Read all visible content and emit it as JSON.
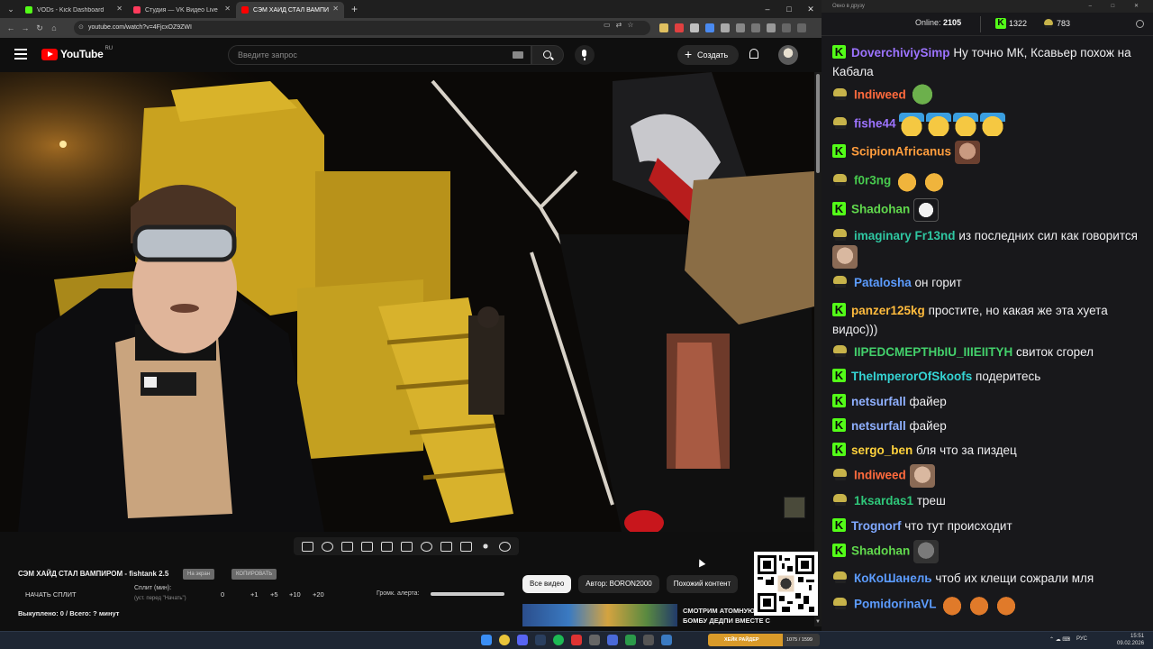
{
  "browser": {
    "tabs": [
      {
        "title": "VODs - Kick Dashboard",
        "favicon_color": "#53fc18"
      },
      {
        "title": "Студия — VK Видео Live",
        "favicon_color": "#ff3b5c"
      },
      {
        "title": "СЭМ ХАЙД СТАЛ ВАМПИР",
        "favicon_color": "#ff0000",
        "active": true
      }
    ],
    "url": "youtube.com/watch?v=4FjcxOZ9ZWI"
  },
  "youtube": {
    "logo_text": "YouTube",
    "region": "RU",
    "search_placeholder": "Введите запрос",
    "create_label": "Создать"
  },
  "stream_panel": {
    "title": "СЭМ ХАЙД СТАЛ ВАМПИРОМ - fishtank 2.5",
    "pill_hide": "На экран",
    "pill_copy": "КОПИРОВАТЬ",
    "start_split": "НАЧАТЬ СПЛИТ",
    "split_min_label": "Сплит (мин):",
    "split_hint": "(уст. перед \"Начать\")",
    "split_value": "0",
    "increments": [
      "+1",
      "+5",
      "+10",
      "+20"
    ],
    "alert_volume_label": "Громк. алерта:",
    "alert_volume": 1.0,
    "payout": "Выкуплено: 0 / Всего: ? минут"
  },
  "filter_chips": [
    "Все видео",
    "Автор: BORON2000",
    "Похожий контент"
  ],
  "recommendation": {
    "title": "СМОТРИМ АТОМНУЮ БОМБУ ДЕДПИ ВМЕСТЕ С ..."
  },
  "chat": {
    "window_title": "Окно в друзу",
    "online_label": "Online:",
    "online_count": "2105",
    "kick_count": "1322",
    "vk_count": "783",
    "messages": [
      {
        "platform": "kick",
        "user": "DoverchiviySimp",
        "color": "#9c73ff",
        "text": "Ну точно МК, Ксавьер похож на Кабала",
        "emotes": []
      },
      {
        "platform": "vk",
        "user": "Indiweed",
        "color": "#ff6a3d",
        "text": "",
        "emotes": [
          "pepe"
        ]
      },
      {
        "platform": "vk",
        "user": "fishe44",
        "color": "#9c73ff",
        "text": "",
        "emotes": [
          "laugh",
          "laugh",
          "laugh",
          "laugh"
        ]
      },
      {
        "platform": "kick",
        "user": "ScipionAfricanus",
        "color": "#ff9d3d",
        "text": "",
        "emotes": [
          "face"
        ]
      },
      {
        "platform": "vk",
        "user": "f0r3ng",
        "color": "#47c94e",
        "text": "",
        "emotes": [
          "cat",
          "cat"
        ]
      },
      {
        "platform": "kick",
        "user": "Shadohan",
        "color": "#61d94d",
        "text": "",
        "emotes": [
          "white"
        ]
      },
      {
        "platform": "vk",
        "user": "imaginary Fr13nd",
        "color": "#2fc7a2",
        "text": "из последних сил как говорится",
        "emotes": [
          "old"
        ]
      },
      {
        "platform": "vk",
        "user": "Patalosha",
        "color": "#5c9cff",
        "text": "он горит",
        "emotes": []
      },
      {
        "platform": "kick",
        "user": "panzer125kg",
        "color": "#ffbb3d",
        "text": "простите, но какая же эта хуета видос)))",
        "emotes": []
      },
      {
        "platform": "vk",
        "user": "IIPEDCMEPTHbIU_IIIEIITYH",
        "color": "#43d06b",
        "text": "свиток сгорел",
        "emotes": []
      },
      {
        "platform": "kick",
        "user": "TheImperorOfSkoofs",
        "color": "#35d4d4",
        "text": "подеритесь",
        "emotes": []
      },
      {
        "platform": "kick",
        "user": "netsurfall",
        "color": "#8fb0ff",
        "text": "файер",
        "emotes": []
      },
      {
        "platform": "kick",
        "user": "netsurfall",
        "color": "#8fb0ff",
        "text": "файер",
        "emotes": []
      },
      {
        "platform": "kick",
        "user": "sergo_ben",
        "color": "#ffd23d",
        "text": "бля что за пиздец",
        "emotes": []
      },
      {
        "platform": "vk",
        "user": "Indiweed",
        "color": "#ff6a3d",
        "text": "",
        "emotes": [
          "old"
        ]
      },
      {
        "platform": "vk",
        "user": "1ksardas1",
        "color": "#2fc77a",
        "text": "треш",
        "emotes": []
      },
      {
        "platform": "kick",
        "user": "Trognorf",
        "color": "#7fa8ff",
        "text": "что тут происходит",
        "emotes": []
      },
      {
        "platform": "kick",
        "user": "Shadohan",
        "color": "#61d94d",
        "text": "",
        "emotes": [
          "dark"
        ]
      },
      {
        "platform": "vk",
        "user": "КоКоШанель",
        "color": "#5c9cff",
        "text": "чтоб их клещи сожрали мля",
        "emotes": []
      },
      {
        "platform": "vk",
        "user": "PomidorinaVL",
        "color": "#5c9cff",
        "text": "",
        "emotes": [
          "fox",
          "fox",
          "fox"
        ]
      }
    ]
  },
  "taskbar": {
    "progress_label": "ХЕЙК РАЙДЕР",
    "progress_text": "1075 / 1599",
    "progress_fraction": 0.67,
    "language": "РУС",
    "time": "15:51",
    "date": "09.02.2026"
  }
}
